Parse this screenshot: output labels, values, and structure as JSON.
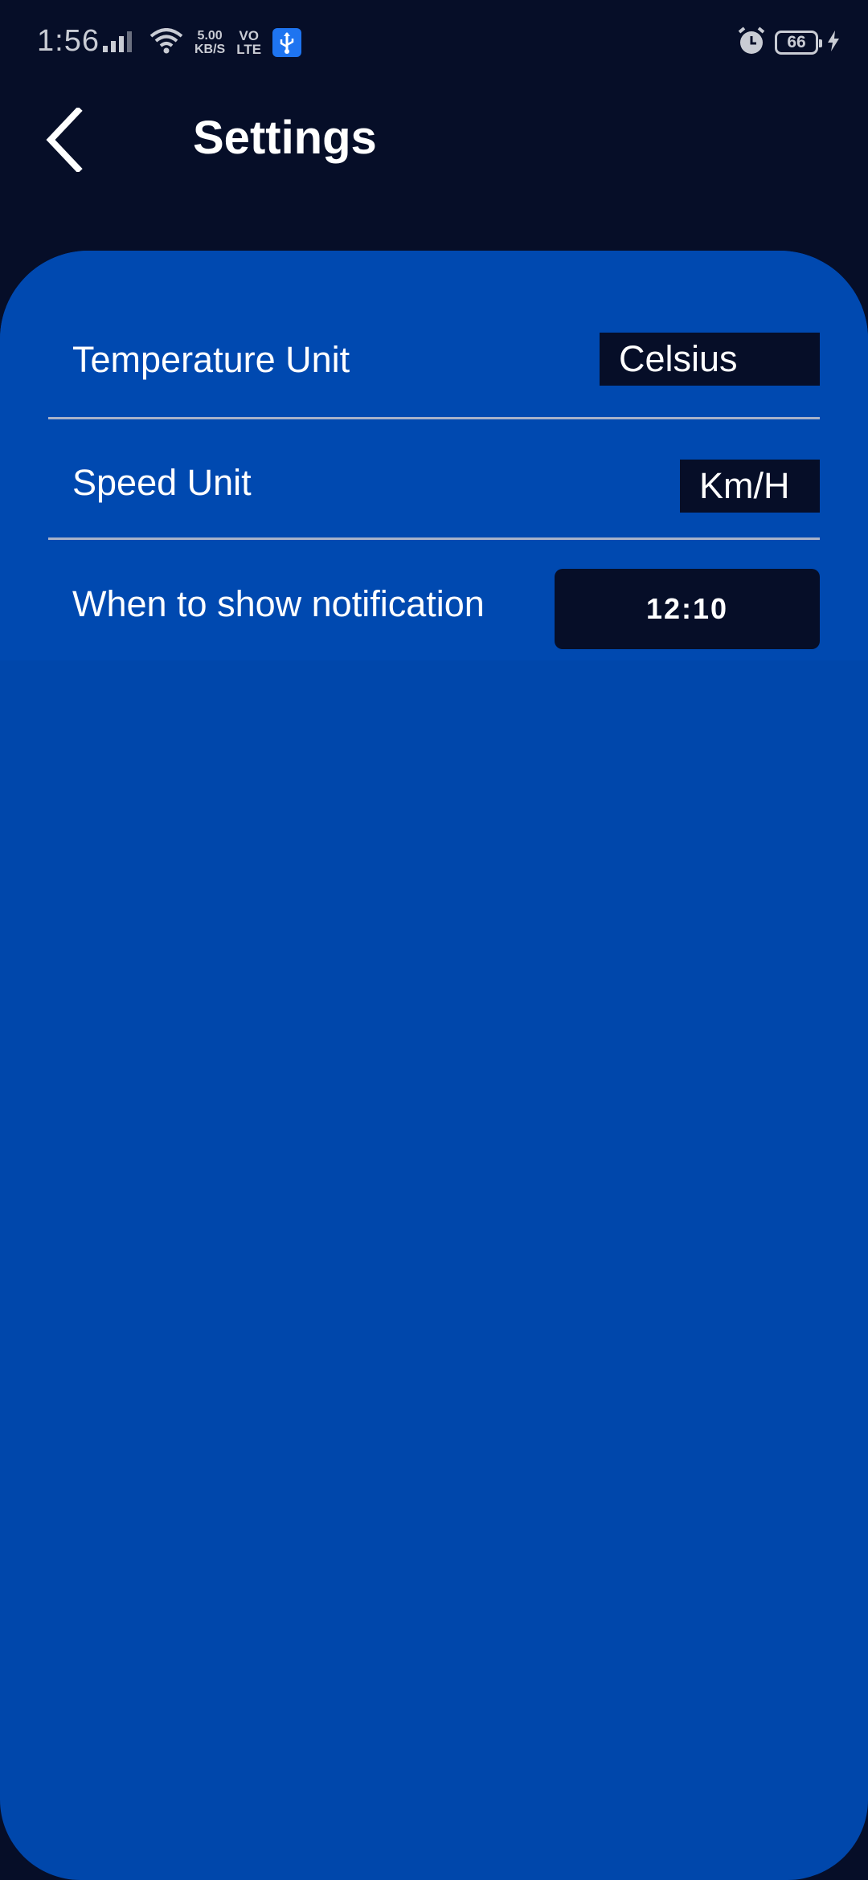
{
  "status_bar": {
    "time": "1:56",
    "net_speed_value": "5.00",
    "net_speed_unit": "KB/S",
    "volte_top": "VO",
    "volte_bottom": "LTE",
    "battery": "66"
  },
  "app_bar": {
    "title": "Settings"
  },
  "settings": {
    "temperature": {
      "label": "Temperature Unit",
      "value": "Celsius"
    },
    "speed": {
      "label": "Speed Unit",
      "value": "Km/H"
    },
    "notification": {
      "label": "When to show notification",
      "value": "12:10"
    }
  },
  "colors": {
    "background": "#060e28",
    "panel": "#0047ab",
    "value_box": "#060e28",
    "divider": "#a7b2c9"
  }
}
